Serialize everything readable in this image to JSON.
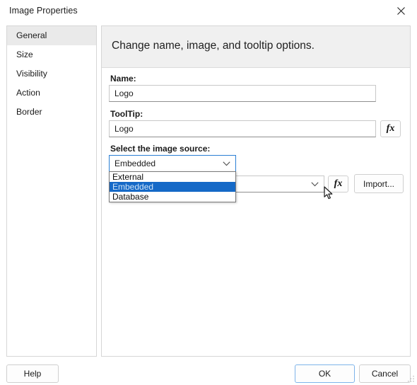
{
  "window": {
    "title": "Image Properties",
    "close_icon": "close-icon"
  },
  "sidebar": {
    "items": [
      {
        "label": "General",
        "selected": true
      },
      {
        "label": "Size",
        "selected": false
      },
      {
        "label": "Visibility",
        "selected": false
      },
      {
        "label": "Action",
        "selected": false
      },
      {
        "label": "Border",
        "selected": false
      }
    ]
  },
  "content": {
    "header": "Change name, image, and tooltip options.",
    "fields": {
      "name": {
        "label": "Name:",
        "value": "Logo",
        "placeholder": ""
      },
      "tooltip": {
        "label": "ToolTip:",
        "value": "Logo",
        "placeholder": "",
        "expression_button": "fx"
      },
      "image_source": {
        "label": "Select the image source:",
        "selected": "Embedded",
        "options": [
          "External",
          "Embedded",
          "Database"
        ],
        "highlighted_option": "Embedded",
        "expanded": true,
        "arrow_icon": "chevron-down-icon"
      },
      "image_value": {
        "label": "",
        "value": "",
        "arrow_icon": "chevron-down-icon",
        "expression_button": "fx",
        "import_label": "Import..."
      }
    }
  },
  "footer": {
    "help_label": "Help",
    "ok_label": "OK",
    "cancel_label": "Cancel"
  },
  "colors": {
    "accent_blue": "#1569c7",
    "focus_blue": "#2a7fd4",
    "ok_focus_blue": "#7eb4ea",
    "header_gray": "#f0f0f0",
    "selected_nav_gray": "#eaeaea",
    "border_gray": "#d6d6d6"
  },
  "cursor": {
    "icon": "arrow-pointer-cursor"
  }
}
